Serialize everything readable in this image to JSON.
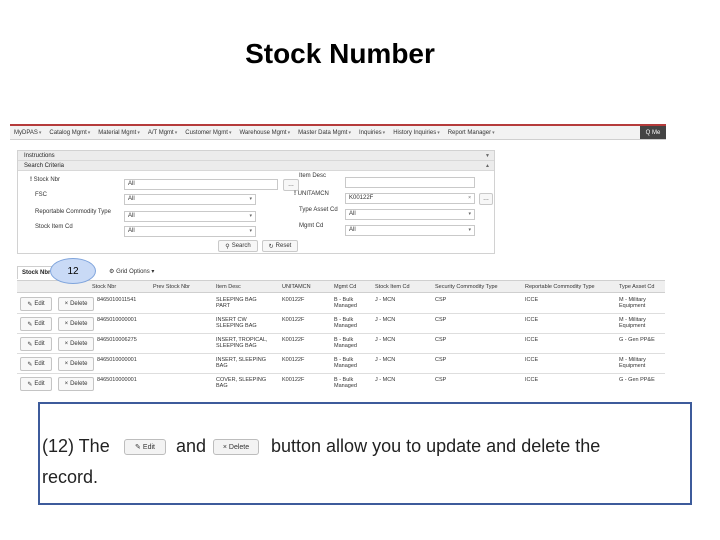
{
  "slide": {
    "title": "Stock Number"
  },
  "nav": {
    "items": [
      "MyDPAS",
      "Catalog Mgmt",
      "Material Mgmt",
      "A/T Mgmt",
      "Customer Mgmt",
      "Warehouse Mgmt",
      "Master Data Mgmt",
      "Inquiries",
      "History Inquiries",
      "Report Manager"
    ],
    "search_label": "Q Me"
  },
  "instructions": {
    "label": "Instructions"
  },
  "criteria": {
    "header": "Search Criteria",
    "stock_nbr": {
      "label": "Stock Nbr",
      "value": "All"
    },
    "fsc": {
      "label": "FSC",
      "value": "All"
    },
    "reportable": {
      "label": "Reportable Commodity Type",
      "value": "All"
    },
    "stock_item_cd": {
      "label": "Stock Item Cd",
      "value": "All"
    },
    "item_desc": {
      "label": "Item Desc",
      "value": ""
    },
    "unitamcn": {
      "label": "UNITAMCN",
      "value": "K00122F"
    },
    "type_asset": {
      "label": "Type Asset Cd",
      "value": "All"
    },
    "mgmt_cd": {
      "label": "Mgmt Cd",
      "value": "All"
    },
    "search_button": "Search",
    "reset_button": "Reset"
  },
  "grid": {
    "tab_label": "Stock Nbr",
    "options_label": "Grid Options",
    "columns": [
      "Stock Nbr",
      "Prev Stock Nbr",
      "Item Desc",
      "UNITAMCN",
      "Mgmt Cd",
      "Stock Item Cd",
      "Security Commodity Type",
      "Reportable Commodity Type",
      "Type Asset Cd"
    ],
    "edit_label": "Edit",
    "delete_label": "Delete",
    "rows": [
      {
        "stock_nbr": "8465010011541",
        "item_desc": "SLEEPING BAG\nPART",
        "unitamcn": "K00122F",
        "mgmt": "B - Bulk\nManaged",
        "stock_item": "J - MCN",
        "security": "CSP",
        "reportable": "ICCE",
        "type_asset": "M - Military\nEquipment"
      },
      {
        "stock_nbr": "8465010000001",
        "item_desc": "INSERT CW\nSLEEPING BAG",
        "unitamcn": "K00122F",
        "mgmt": "B - Bulk\nManaged",
        "stock_item": "J - MCN",
        "security": "CSP",
        "reportable": "ICCE",
        "type_asset": "M - Military\nEquipment"
      },
      {
        "stock_nbr": "8465010006275",
        "item_desc": "INSERT, TROPICAL,\nSLEEPING BAG",
        "unitamcn": "K00122F",
        "mgmt": "B - Bulk\nManaged",
        "stock_item": "J - MCN",
        "security": "CSP",
        "reportable": "ICCE",
        "type_asset": "G - Gen PP&E"
      },
      {
        "stock_nbr": "8465010000001",
        "item_desc": "INSERT, SLEEPING\nBAG",
        "unitamcn": "K00122F",
        "mgmt": "B - Bulk\nManaged",
        "stock_item": "J - MCN",
        "security": "CSP",
        "reportable": "ICCE",
        "type_asset": "M - Military\nEquipment"
      },
      {
        "stock_nbr": "8465010000001",
        "item_desc": "COVER, SLEEPING\nBAG",
        "unitamcn": "K00122F",
        "mgmt": "B - Bulk\nManaged",
        "stock_item": "J - MCN",
        "security": "CSP",
        "reportable": "ICCE",
        "type_asset": "G - Gen PP&E"
      }
    ]
  },
  "callout": {
    "number": "12"
  },
  "note": {
    "part1": "(12) The",
    "edit_btn": "Edit",
    "part2": "and",
    "delete_btn": "× Delete",
    "part3": "button allow you to update and delete the",
    "part4": "record."
  }
}
